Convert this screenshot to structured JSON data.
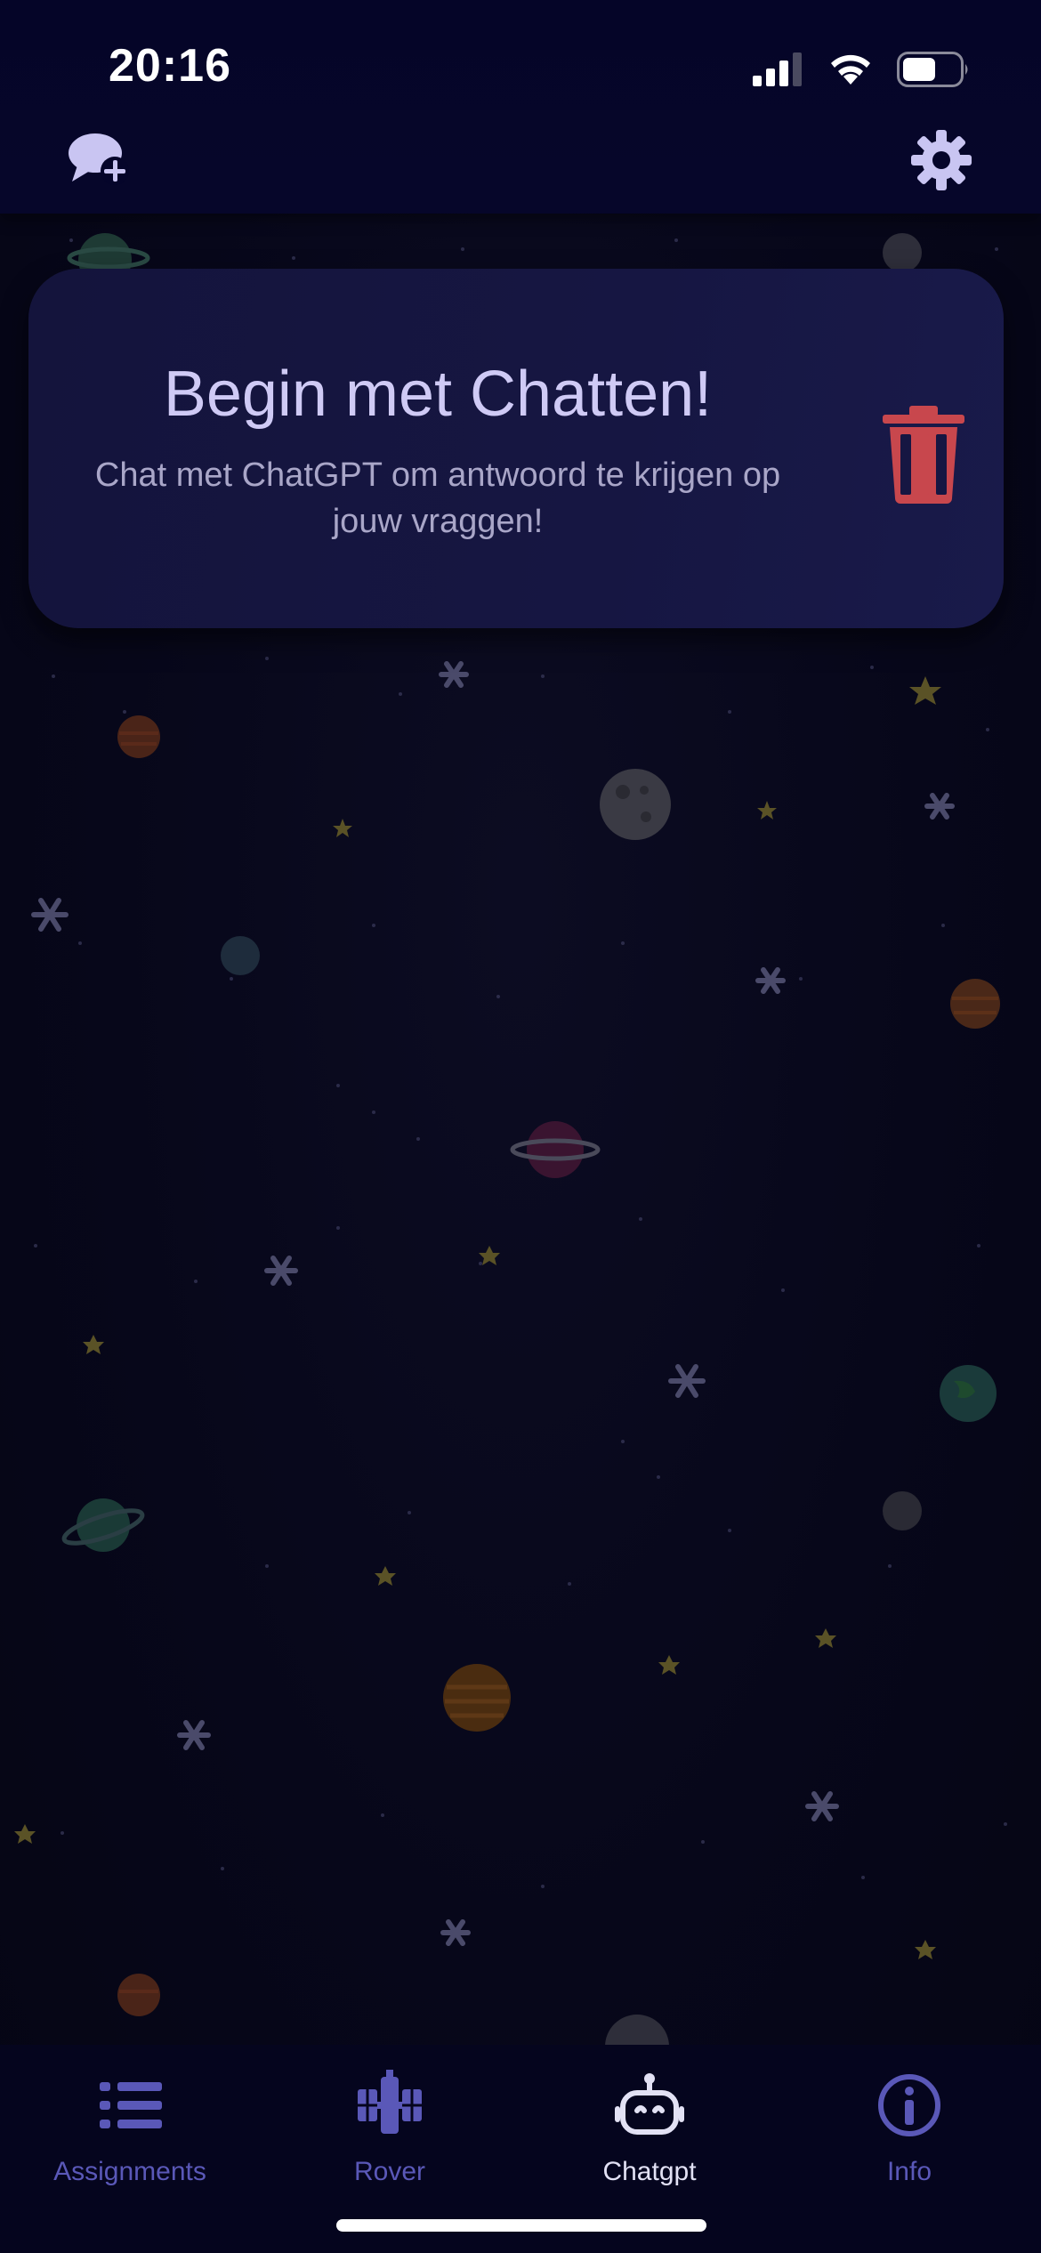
{
  "status_bar": {
    "time": "20:16",
    "signal_icon": "cellular-signal-icon",
    "wifi_icon": "wifi-icon",
    "battery_icon": "battery-icon"
  },
  "top_nav": {
    "new_chat_icon": "chat-bubble-plus-icon",
    "settings_icon": "gear-icon"
  },
  "card": {
    "title": "Begin met Chatten!",
    "subtitle": "Chat met ChatGPT om antwoord te krijgen op jouw vraggen!",
    "delete_icon": "trash-icon"
  },
  "tabs": [
    {
      "label": "Assignments",
      "icon": "list-icon",
      "active": false
    },
    {
      "label": "Rover",
      "icon": "satellite-icon",
      "active": false
    },
    {
      "label": "Chatgpt",
      "icon": "robot-icon",
      "active": true
    },
    {
      "label": "Info",
      "icon": "info-circle-icon",
      "active": false
    }
  ],
  "colors": {
    "background": "#07071a",
    "topbar": "#05052a",
    "card": "#161642",
    "accent": "#5a58b8",
    "danger": "#c8474d",
    "active_tab": "#e2e1f4"
  }
}
